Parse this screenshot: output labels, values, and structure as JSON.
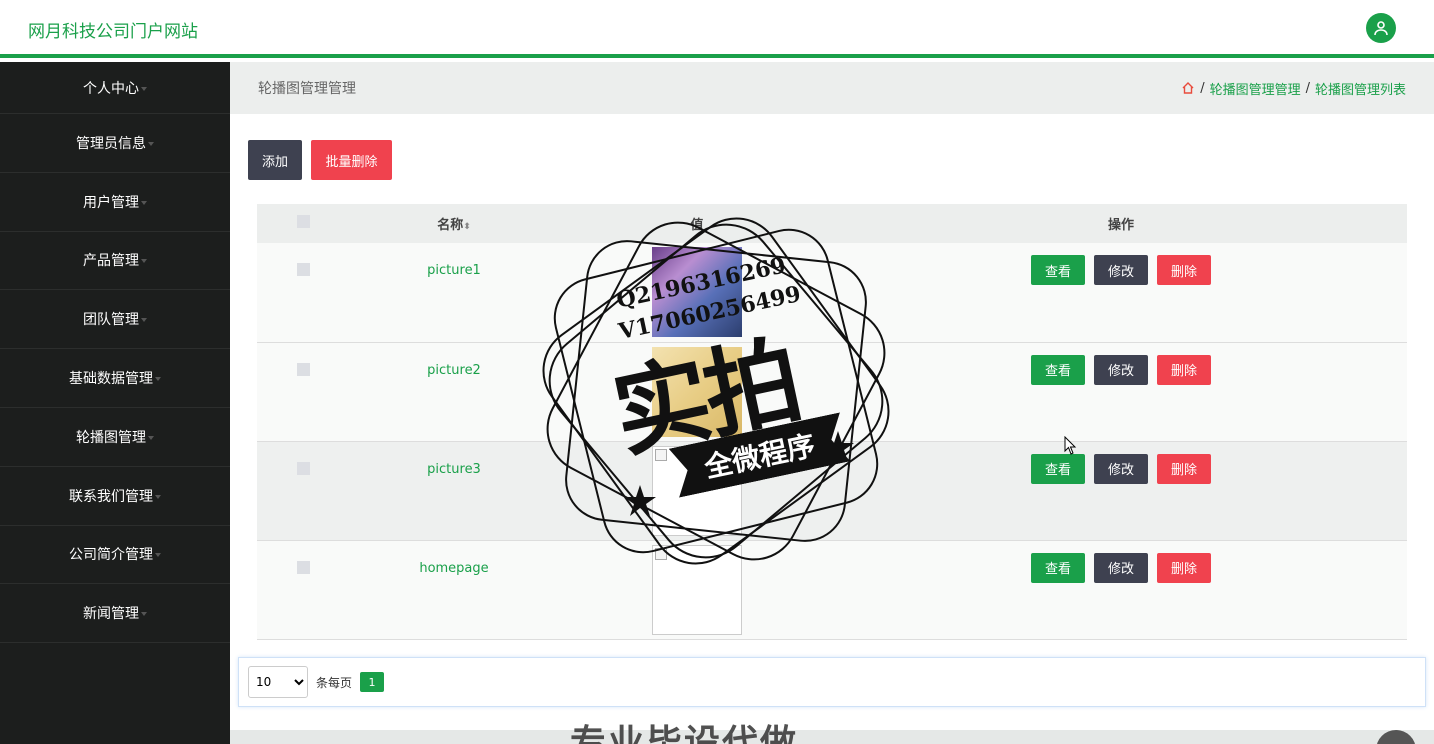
{
  "app": {
    "title": "网月科技公司门户网站"
  },
  "sidebar": {
    "items": [
      {
        "label": "个人中心"
      },
      {
        "label": "管理员信息"
      },
      {
        "label": "用户管理"
      },
      {
        "label": "产品管理"
      },
      {
        "label": "团队管理"
      },
      {
        "label": "基础数据管理"
      },
      {
        "label": "轮播图管理"
      },
      {
        "label": "联系我们管理"
      },
      {
        "label": "公司简介管理"
      },
      {
        "label": "新闻管理"
      }
    ]
  },
  "page": {
    "title": "轮播图管理管理",
    "breadcrumb": [
      "轮播图管理管理",
      "轮播图管理列表"
    ],
    "breadcrumb_sep": "/"
  },
  "toolbar": {
    "add_label": "添加",
    "batch_delete_label": "批量删除"
  },
  "table": {
    "headers": {
      "name": "名称",
      "value": "值",
      "ops": "操作"
    },
    "rows": [
      {
        "name": "picture1"
      },
      {
        "name": "picture2"
      },
      {
        "name": "picture3"
      },
      {
        "name": "homepage"
      }
    ],
    "ops": {
      "view": "查看",
      "edit": "修改",
      "delete": "删除"
    }
  },
  "pager": {
    "page_size": "10",
    "per_page_label": "条每页",
    "current_page": "1"
  },
  "watermark": {
    "line1": "Q2196316269",
    "line2": "V17060256499",
    "main": "实拍",
    "ribbon": "全微程序",
    "bottom": "专业毕设代做"
  },
  "colors": {
    "accent": "#1aa04a",
    "danger": "#f0424e",
    "dark": "#3e4150",
    "sidebar": "#1c1e1d"
  }
}
